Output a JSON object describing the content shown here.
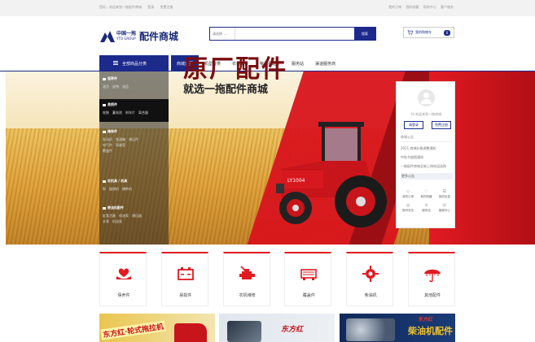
{
  "topbar": {
    "left": [
      "您好，欢迎来到一拖配件商城",
      "登录",
      "免费注册"
    ],
    "right": [
      "我的订单",
      "我的收藏",
      "帮助中心",
      "客户服务"
    ]
  },
  "header": {
    "logo_cn": "中国一拖",
    "logo_en": "YTO GROUP",
    "logo_title": "配件商城",
    "search_select": "请选择",
    "search_placeholder": "",
    "search_button": "搜索",
    "cart_label": "我的购物车",
    "cart_count": "0"
  },
  "nav": {
    "category_label": "全部商品分类",
    "items": [
      "商城首页",
      "机型分类",
      "农机配件",
      "柴油机配件",
      "服务站",
      "渠道服务商"
    ],
    "active_index": 0
  },
  "sidemenu": {
    "groups": [
      {
        "title": "保养件",
        "links": [
          "滤芯",
          "皮带",
          "油品"
        ]
      },
      {
        "title": "易损件",
        "links": [
          "轮胎",
          "蓄电池",
          "刹车片",
          "离合器"
        ]
      },
      {
        "title": "维修件",
        "links": [
          "发动机",
          "变速箱",
          "液压件",
          "电气件",
          "驾驶室",
          "覆盖件"
        ]
      },
      {
        "title": "农机具 / 机具",
        "links": [
          "犁",
          "旋耕机",
          "播种机"
        ]
      },
      {
        "title": "柴油机配件",
        "links": [
          "缸套活塞",
          "喷油泵",
          "增压器",
          "水泵",
          "机油泵"
        ]
      }
    ]
  },
  "banner": {
    "headline": "原厂配件",
    "subline": "就选一拖配件商城",
    "tractor_brand": "LY1004"
  },
  "panel": {
    "welcome": "Hi 欢迎来到一拖商城",
    "login": "请登录",
    "register": "免费注册",
    "news_title": "商城公告",
    "news": [
      "2021 商城价格调整通知",
      "中秋节放假通知",
      "一拖配件商城全新上线欢迎选购",
      "更多公告"
    ],
    "grid": [
      {
        "icon": "◇",
        "label": "我的订单"
      },
      {
        "icon": "♡",
        "label": "我的收藏"
      },
      {
        "icon": "☰",
        "label": "我的足迹"
      },
      {
        "icon": "◎",
        "label": "账号安全"
      },
      {
        "icon": "⊙",
        "label": "服务站"
      },
      {
        "icon": "☏",
        "label": "客服中心"
      }
    ]
  },
  "categories": [
    {
      "label": "保养件",
      "icon": "care"
    },
    {
      "label": "易损件",
      "icon": "battery"
    },
    {
      "label": "农机维修",
      "icon": "engine-repair"
    },
    {
      "label": "覆盖件",
      "icon": "cover"
    },
    {
      "label": "柴油机",
      "icon": "diesel"
    },
    {
      "label": "其他配件",
      "icon": "umbrella"
    }
  ],
  "promos": [
    {
      "text": "东方红·轮式拖拉机"
    },
    {
      "text": "东方红"
    },
    {
      "t1": "东方红",
      "t2": "柴油机配件"
    }
  ],
  "colors": {
    "brand_blue": "#1c2a8c",
    "accent_red": "#e21a22"
  }
}
